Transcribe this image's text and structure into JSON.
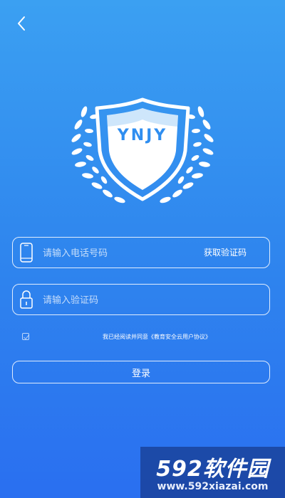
{
  "nav": {
    "back_icon": "chevron-left-icon"
  },
  "logo": {
    "text": "YNJY",
    "icon": "shield-laurel-icon"
  },
  "phone_field": {
    "placeholder": "请输入电话号码",
    "value": "",
    "icon": "phone-icon",
    "get_code_label": "获取验证码"
  },
  "code_field": {
    "placeholder": "请输入验证码",
    "value": "",
    "icon": "lock-icon"
  },
  "agreement": {
    "checked": false,
    "prefix": "我已经阅读并同意",
    "link": "《教育安全云用户协议》"
  },
  "login": {
    "label": "登录"
  },
  "watermark": {
    "brand": "592软件园",
    "url": "www.592xiazai.com"
  },
  "colors": {
    "background_top": "#3ba0f2",
    "background_bottom": "#2a6ff0",
    "foreground": "#ffffff"
  }
}
